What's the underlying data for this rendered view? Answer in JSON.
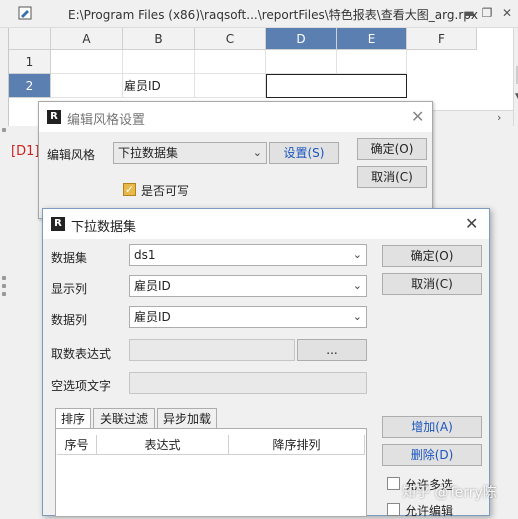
{
  "window": {
    "title": "E:\\Program Files (x86)\\raqsoft...\\reportFiles\\特色报表\\查看大图_arg.rpx",
    "minimize": "▬",
    "restore": "❐",
    "close": "✕"
  },
  "sheet": {
    "columns": [
      "A",
      "B",
      "C",
      "D",
      "E",
      "F"
    ],
    "rows": [
      "1",
      "2"
    ],
    "cells": {
      "B2": "雇员ID"
    },
    "selected_columns": [
      "D",
      "E"
    ],
    "cell_ref": "[D1]"
  },
  "dialog_style": {
    "title": "编辑风格设置",
    "style_label": "编辑风格",
    "style_value": "下拉数据集",
    "settings_button": "设置(S)",
    "ok_button": "确定(O)",
    "cancel_button": "取消(C)",
    "writable_label": "是否可写",
    "writable_checked": true
  },
  "dialog_dataset": {
    "title": "下拉数据集",
    "dataset_label": "数据集",
    "dataset_value": "ds1",
    "display_col_label": "显示列",
    "display_col_value": "雇员ID",
    "data_col_label": "数据列",
    "data_col_value": "雇员ID",
    "expr_label": "取数表达式",
    "expr_button": "...",
    "empty_text_label": "空选项文字",
    "ok_button": "确定(O)",
    "cancel_button": "取消(C)",
    "tabs": [
      "排序",
      "关联过滤",
      "异步加载"
    ],
    "active_tab": 0,
    "table_headers": [
      "序号",
      "表达式",
      "降序排列"
    ],
    "add_button": "增加(A)",
    "delete_button": "删除(D)",
    "allow_multi_label": "允许多选",
    "allow_edit_label": "允许编辑"
  },
  "watermark": "知乎 @Terry陈"
}
